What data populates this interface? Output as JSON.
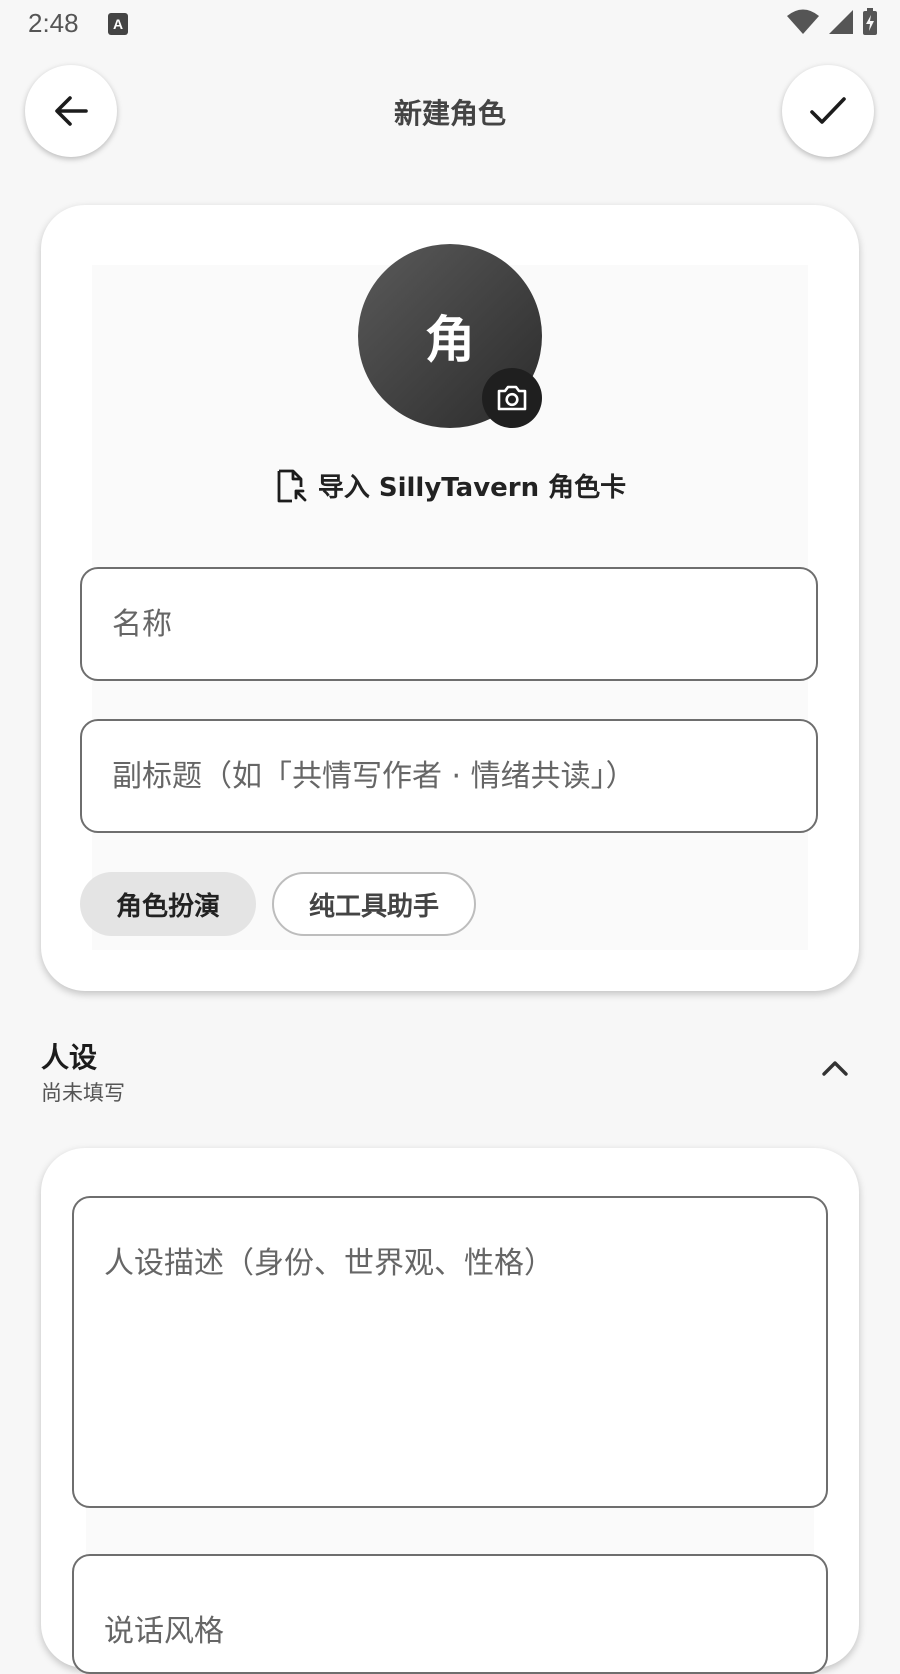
{
  "status_bar": {
    "time": "2:48",
    "notification_icon_letter": "A"
  },
  "header": {
    "title": "新建角色"
  },
  "profile": {
    "avatar_char": "角",
    "import_label": "导入 SillyTavern 角色卡",
    "name_placeholder": "名称",
    "subtitle_placeholder": "副标题（如「共情写作者 · 情绪共读」）",
    "mode_chips": [
      {
        "label": "角色扮演",
        "selected": true
      },
      {
        "label": "纯工具助手",
        "selected": false
      }
    ]
  },
  "persona": {
    "section_title": "人设",
    "section_status": "尚未填写",
    "description_placeholder": "人设描述（身份、世界观、性格）",
    "style_placeholder": "说话风格"
  },
  "colors": {
    "background": "#f7f7f7",
    "avatar": "#3d3d3d",
    "chip_selected": "#e4e4e4"
  }
}
